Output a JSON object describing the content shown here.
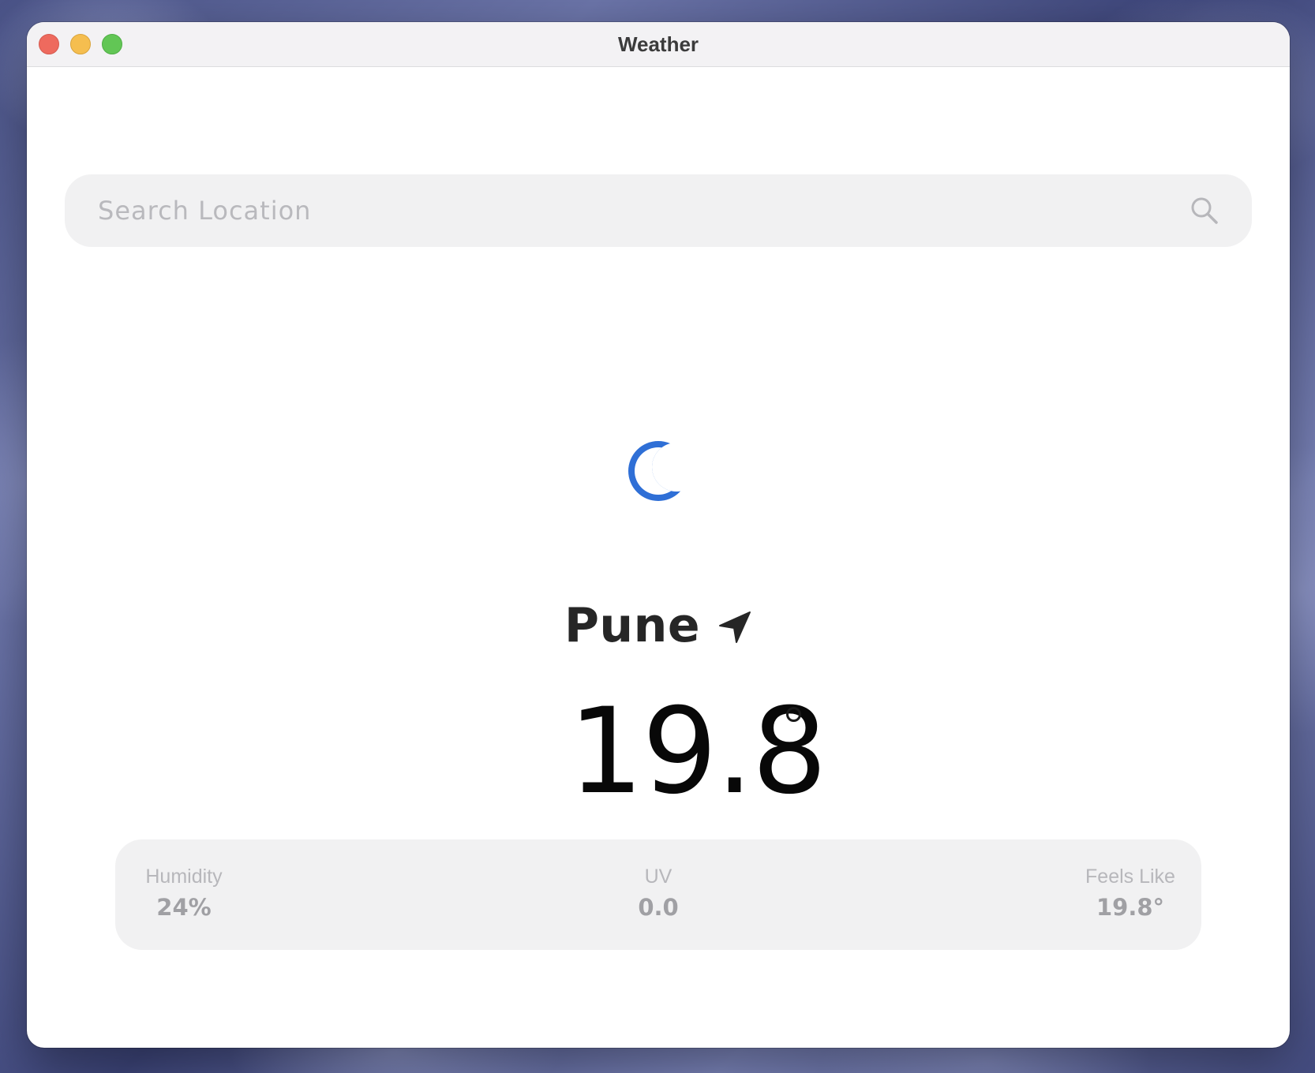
{
  "window": {
    "title": "Weather"
  },
  "search": {
    "placeholder": "Search Location",
    "value": "",
    "icon": "search-icon"
  },
  "weather": {
    "condition_icon": "moon-icon",
    "condition_color": "#2f6fd6",
    "city": "Pune",
    "location_icon": "location-arrow-icon",
    "temperature": "19.8"
  },
  "stats": {
    "humidity": {
      "label": "Humidity",
      "value": "24%"
    },
    "uv": {
      "label": "UV",
      "value": "0.0"
    },
    "feels_like": {
      "label": "Feels Like",
      "value": "19.8°"
    }
  },
  "colors": {
    "close": "#ee6a5e",
    "minimize": "#f5be4f",
    "zoom": "#62c655"
  }
}
